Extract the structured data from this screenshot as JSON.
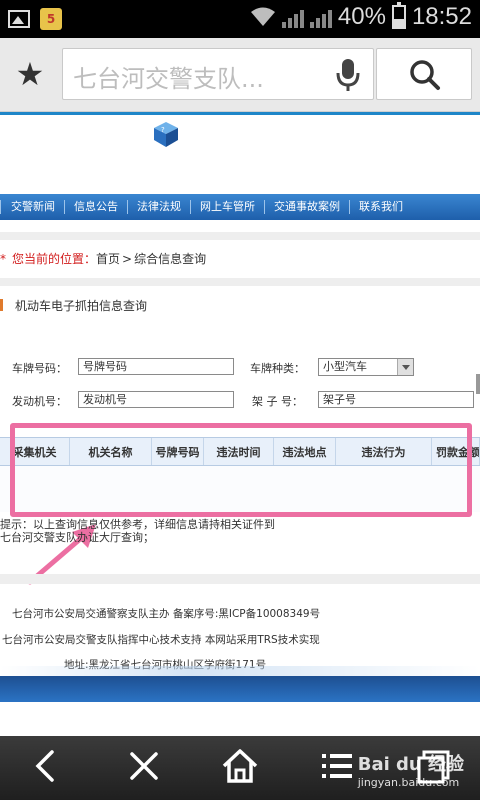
{
  "status_bar": {
    "battery_percent": "40%",
    "time": "18:52",
    "battery_level": 0.4
  },
  "browser": {
    "address_text": "七台河交警支队..."
  },
  "nav_menu": [
    "交警新闻",
    "信息公告",
    "法律法规",
    "网上车管所",
    "交通事故案例",
    "联系我们"
  ],
  "breadcrumb": {
    "label": "您当前的位置：",
    "home": "首页",
    "arrow": ">",
    "current": "综合信息查询"
  },
  "section_title": "机动车电子抓拍信息查询",
  "form": {
    "plate_label": "车牌号码：",
    "plate_value": "号牌号码",
    "plate_type_label": "车牌种类：",
    "plate_type_value": "小型汽车",
    "engine_label": "发动机号：",
    "engine_value": "发动机号",
    "frame_label": "架 子 号：",
    "frame_value": "架子号"
  },
  "table": {
    "headers": [
      "采集机关",
      "机关名称",
      "号牌号码",
      "违法时间",
      "违法地点",
      "违法行为",
      "罚款金额"
    ]
  },
  "notes": {
    "line1": "提示：以上查询信息仅供参考，详细信息请持相关证件到",
    "line2": "七台河交警支队办证大厅查询；"
  },
  "footer": {
    "line1": "七台河市公安局交通警察支队主办 备案序号:黑ICP备10008349号",
    "line2": "七台河市公安局交警支队指挥中心技术支持 本网站采用TRS技术实现",
    "line3": "地址:黑龙江省七台河市桃山区学府街171号"
  },
  "watermark": {
    "brand": "Bai du 经验",
    "url": "jingyan.baidu.com"
  },
  "colors": {
    "highlight": "#ec6fa2",
    "nav_blue": "#1e5fab",
    "accent_red": "#d21d1d"
  }
}
